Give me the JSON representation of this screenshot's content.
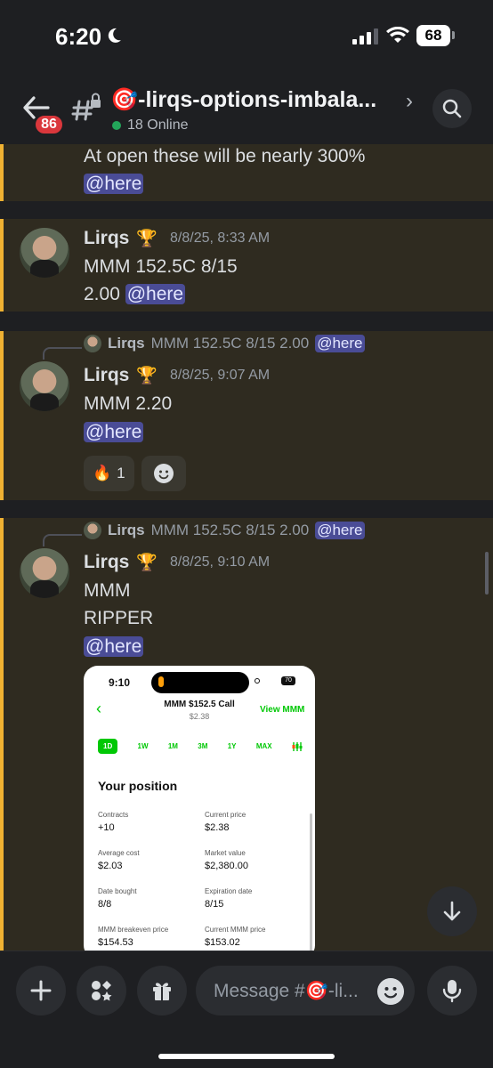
{
  "status_bar": {
    "time": "6:20",
    "battery": "68"
  },
  "header": {
    "unread_badge": "86",
    "channel_title": "🎯-lirqs-options-imbala...",
    "online": "18 Online",
    "chevron": "›"
  },
  "messages": [
    {
      "lines": [
        "At open these will be nearly 300%"
      ],
      "mention": "@here"
    },
    {
      "author": "Lirqs",
      "badge": "🏆",
      "timestamp": "8/8/25, 8:33 AM",
      "lines": [
        "MMM 152.5C 8/15",
        "2.00"
      ],
      "mention": "@here"
    },
    {
      "reply": {
        "author": "Lirqs",
        "text": "MMM 152.5C 8/15 2.00",
        "mention": "@here"
      },
      "author": "Lirqs",
      "badge": "🏆",
      "timestamp": "8/8/25, 9:07 AM",
      "lines": [
        "MMM 2.20"
      ],
      "mention": "@here",
      "reactions": [
        {
          "emoji": "🔥",
          "count": "1"
        }
      ]
    },
    {
      "reply": {
        "author": "Lirqs",
        "text": "MMM 152.5C 8/15 2.00",
        "mention": "@here"
      },
      "author": "Lirqs",
      "badge": "🏆",
      "timestamp": "8/8/25, 9:10 AM",
      "lines": [
        "MMM",
        "RIPPER"
      ],
      "mention": "@here"
    }
  ],
  "attachment": {
    "status_time": "9:10",
    "battery": "70",
    "title": "MMM $152.5 Call",
    "price": "$2.38",
    "view_link": "View MMM",
    "ranges": [
      "1D",
      "1W",
      "1M",
      "3M",
      "1Y",
      "MAX"
    ],
    "selected_range": "1D",
    "section_title": "Your position",
    "fields": [
      {
        "label": "Contracts",
        "value": "+10"
      },
      {
        "label": "Current price",
        "value": "$2.38"
      },
      {
        "label": "Average cost",
        "value": "$2.03"
      },
      {
        "label": "Market value",
        "value": "$2,380.00"
      },
      {
        "label": "Date bought",
        "value": "8/8"
      },
      {
        "label": "Expiration date",
        "value": "8/15"
      },
      {
        "label": "MMM breakeven price",
        "value": "$154.53"
      },
      {
        "label": "Current MMM price",
        "value": "$153.02"
      }
    ]
  },
  "composer": {
    "placeholder": "Message #🎯-li..."
  },
  "colors": {
    "accent_bar": "#f0b232",
    "mention_bg": "#4a4c96",
    "online": "#23a55a",
    "badge": "#da373c",
    "robinhood_green": "#00c805"
  },
  "icons": [
    "moon-icon",
    "signal-icon",
    "wifi-icon",
    "back-arrow-icon",
    "hash-lock-icon",
    "search-icon",
    "plus-icon",
    "apps-icon",
    "gift-icon",
    "emoji-icon",
    "mic-icon",
    "arrow-down-icon",
    "add-reaction-icon",
    "chart-settings-icon"
  ]
}
